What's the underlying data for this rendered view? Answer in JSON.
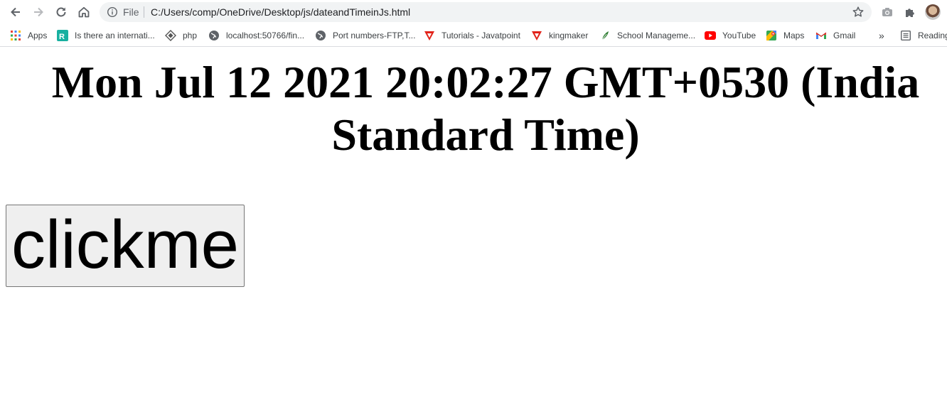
{
  "browser": {
    "address_bar": {
      "scheme_label": "File",
      "url": "C:/Users/comp/OneDrive/Desktop/js/dateandTimeinJs.html"
    },
    "bookmarks": [
      {
        "label": "Apps",
        "icon": "apps-grid-icon"
      },
      {
        "label": "Is there an internati...",
        "icon": "r-favicon-icon"
      },
      {
        "label": "php",
        "icon": "php-favicon-icon"
      },
      {
        "label": "localhost:50766/fin...",
        "icon": "globe-icon"
      },
      {
        "label": "Port numbers-FTP,T...",
        "icon": "globe-icon"
      },
      {
        "label": "Tutorials - Javatpoint",
        "icon": "javatpoint-favicon-icon"
      },
      {
        "label": "kingmaker",
        "icon": "javatpoint-favicon-icon"
      },
      {
        "label": "School Manageme...",
        "icon": "leaf-favicon-icon"
      },
      {
        "label": "YouTube",
        "icon": "youtube-icon"
      },
      {
        "label": "Maps",
        "icon": "maps-icon"
      },
      {
        "label": "Gmail",
        "icon": "gmail-icon"
      }
    ],
    "overflow_label": "»",
    "reading_list_label": "Reading"
  },
  "page": {
    "datetime_text": "Mon Jul 12 2021 20:02:27 GMT+0530 (India Standard Time)",
    "button_label": "clickme"
  },
  "colors": {
    "toolbar_icon": "#5f6368",
    "omnibox_bg": "#f1f3f4",
    "button_bg": "#efefef",
    "button_border": "#767676"
  }
}
